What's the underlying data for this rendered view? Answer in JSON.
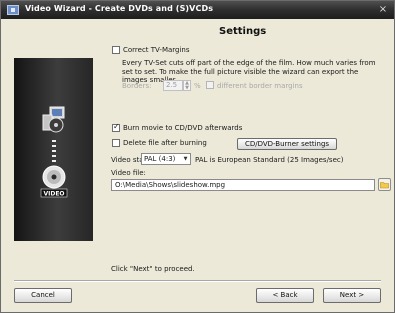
{
  "window": {
    "title": "Video Wizard - Create DVDs and (S)VCDs",
    "close_symbol": "×"
  },
  "heading": "Settings",
  "correct_margins": {
    "label": "Correct TV-Margins",
    "checked": false,
    "description": "Every TV-Set cuts off part of the edge of the film. How much varies from set to set. To make the full picture visible the wizard can export the images smaller.",
    "borders_label": "Borders:",
    "borders_value": "2.5",
    "percent_symbol": "%",
    "different_margins_label": "different border margins"
  },
  "burn": {
    "label": "Burn movie to CD/DVD afterwards",
    "checked": true
  },
  "delete_file": {
    "label": "Delete file after burning",
    "checked": false
  },
  "burner_settings_button": "CD/DVD-Burner settings",
  "video_standard": {
    "label": "Video stan",
    "selected": "PAL (4:3)",
    "note": "PAL is European Standard (25 Images/sec)"
  },
  "video_file": {
    "label": "Video file:",
    "value": "O:\\Media\\Shows\\slideshow.mpg"
  },
  "hint": "Click \"Next\" to proceed.",
  "footer": {
    "cancel": "Cancel",
    "back": "< Back",
    "next": "Next >"
  },
  "icons": {
    "app": "video-wizard-icon",
    "computer": "computer-icon",
    "dvd": "dvd-video-icon",
    "folder": "folder-icon"
  },
  "panel_label": "VIDEO"
}
